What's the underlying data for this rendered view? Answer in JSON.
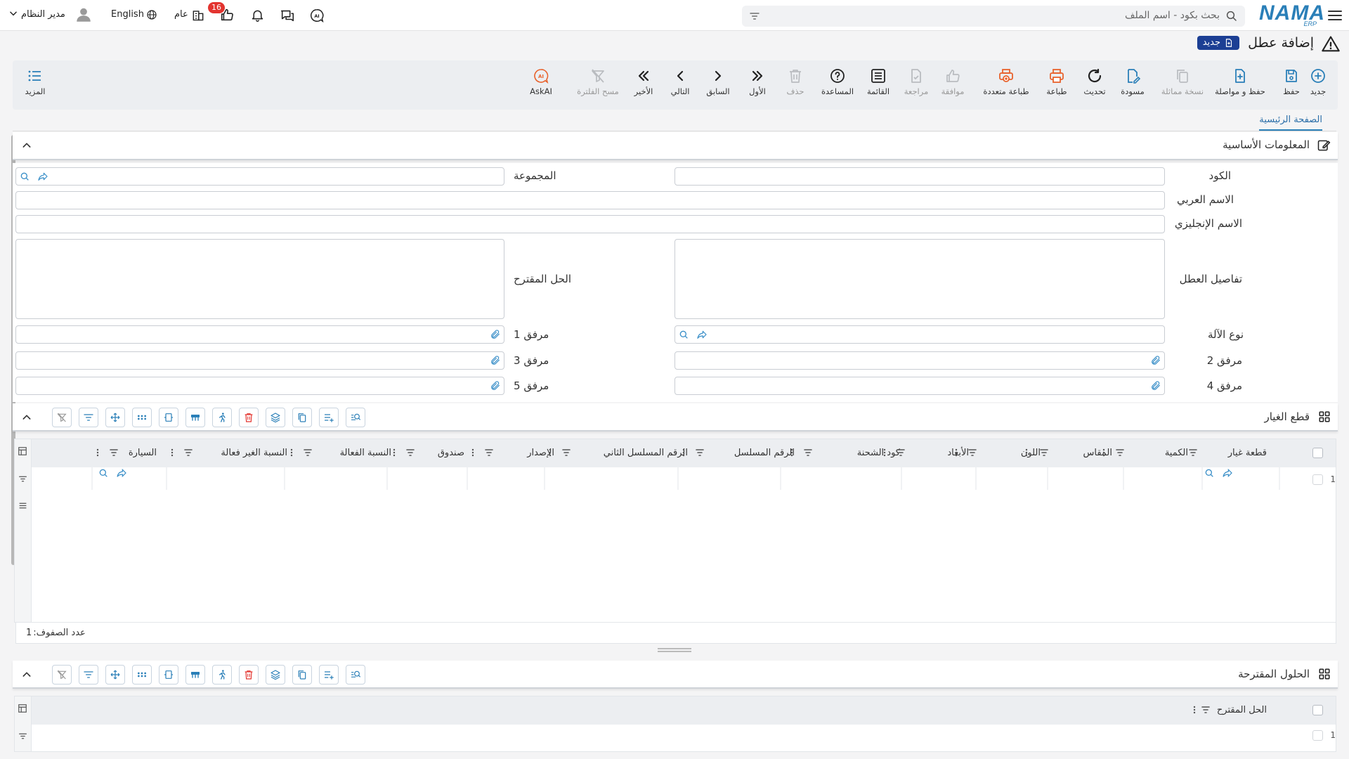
{
  "topbar": {
    "logo": "NAMA",
    "logo_sub": "ERP",
    "search_placeholder": "بحث بكود - اسم الملف",
    "user_name": "مدير النظام",
    "language": "English",
    "scope": "عام",
    "notification_count": "16"
  },
  "page": {
    "title": "إضافة عطل",
    "status_badge": "جديد"
  },
  "toolbar": {
    "new": "جديد",
    "save": "حفظ",
    "save_continue": "حفظ و مواصلة",
    "duplicate": "نسخة مماثلة",
    "draft": "مسودة",
    "refresh": "تحديث",
    "print": "طباعة",
    "multi_print": "طباعة متعددة",
    "approve": "موافقة",
    "review": "مراجعة",
    "list": "القائمة",
    "help": "المساعدة",
    "delete": "حذف",
    "first": "الأول",
    "previous": "السابق",
    "next": "التالي",
    "last": "الأخير",
    "clear_filter": "مسح الفلترة",
    "askai": "AskAI",
    "more": "المزيد"
  },
  "tabs": {
    "home": "الصفحة الرئيسية"
  },
  "basic_info": {
    "title": "المعلومات الأساسية",
    "code_label": "الكود",
    "group_label": "المجموعة",
    "arabic_name_label": "الاسم العربي",
    "english_name_label": "الاسم الإنجليزي",
    "fault_details_label": "تفاصيل العطل",
    "suggested_solution_label": "الحل المقترح",
    "machine_type_label": "نوع الآلة",
    "attachment1_label": "مرفق 1",
    "attachment2_label": "مرفق 2",
    "attachment3_label": "مرفق 3",
    "attachment4_label": "مرفق 4",
    "attachment5_label": "مرفق 5"
  },
  "spare_parts": {
    "title": "قطع الغيار",
    "columns": [
      "قطعة غيار",
      "الكمية",
      "المقاس",
      "اللون",
      "الأبعاد",
      "كود الشحنة",
      "الرقم المسلسل",
      "الرقم المسلسل الثاني",
      "الإصدار",
      "صندوق",
      "النسبة الفعالة",
      "النسبة الغير فعالة",
      "السيارة"
    ],
    "rows": [
      {
        "num": "1"
      }
    ],
    "row_count_label": "عدد الصفوف:",
    "row_count": "1"
  },
  "solutions": {
    "title": "الحلول المقترحة",
    "columns": [
      "الحل المقترح"
    ],
    "rows": [
      {
        "num": "1"
      }
    ]
  },
  "colors": {
    "accent": "#2a7fb8",
    "badge_bg": "#1c3f94",
    "notify": "#e3342f",
    "print_orange": "#e8622c",
    "delete_red": "#e3342f"
  }
}
